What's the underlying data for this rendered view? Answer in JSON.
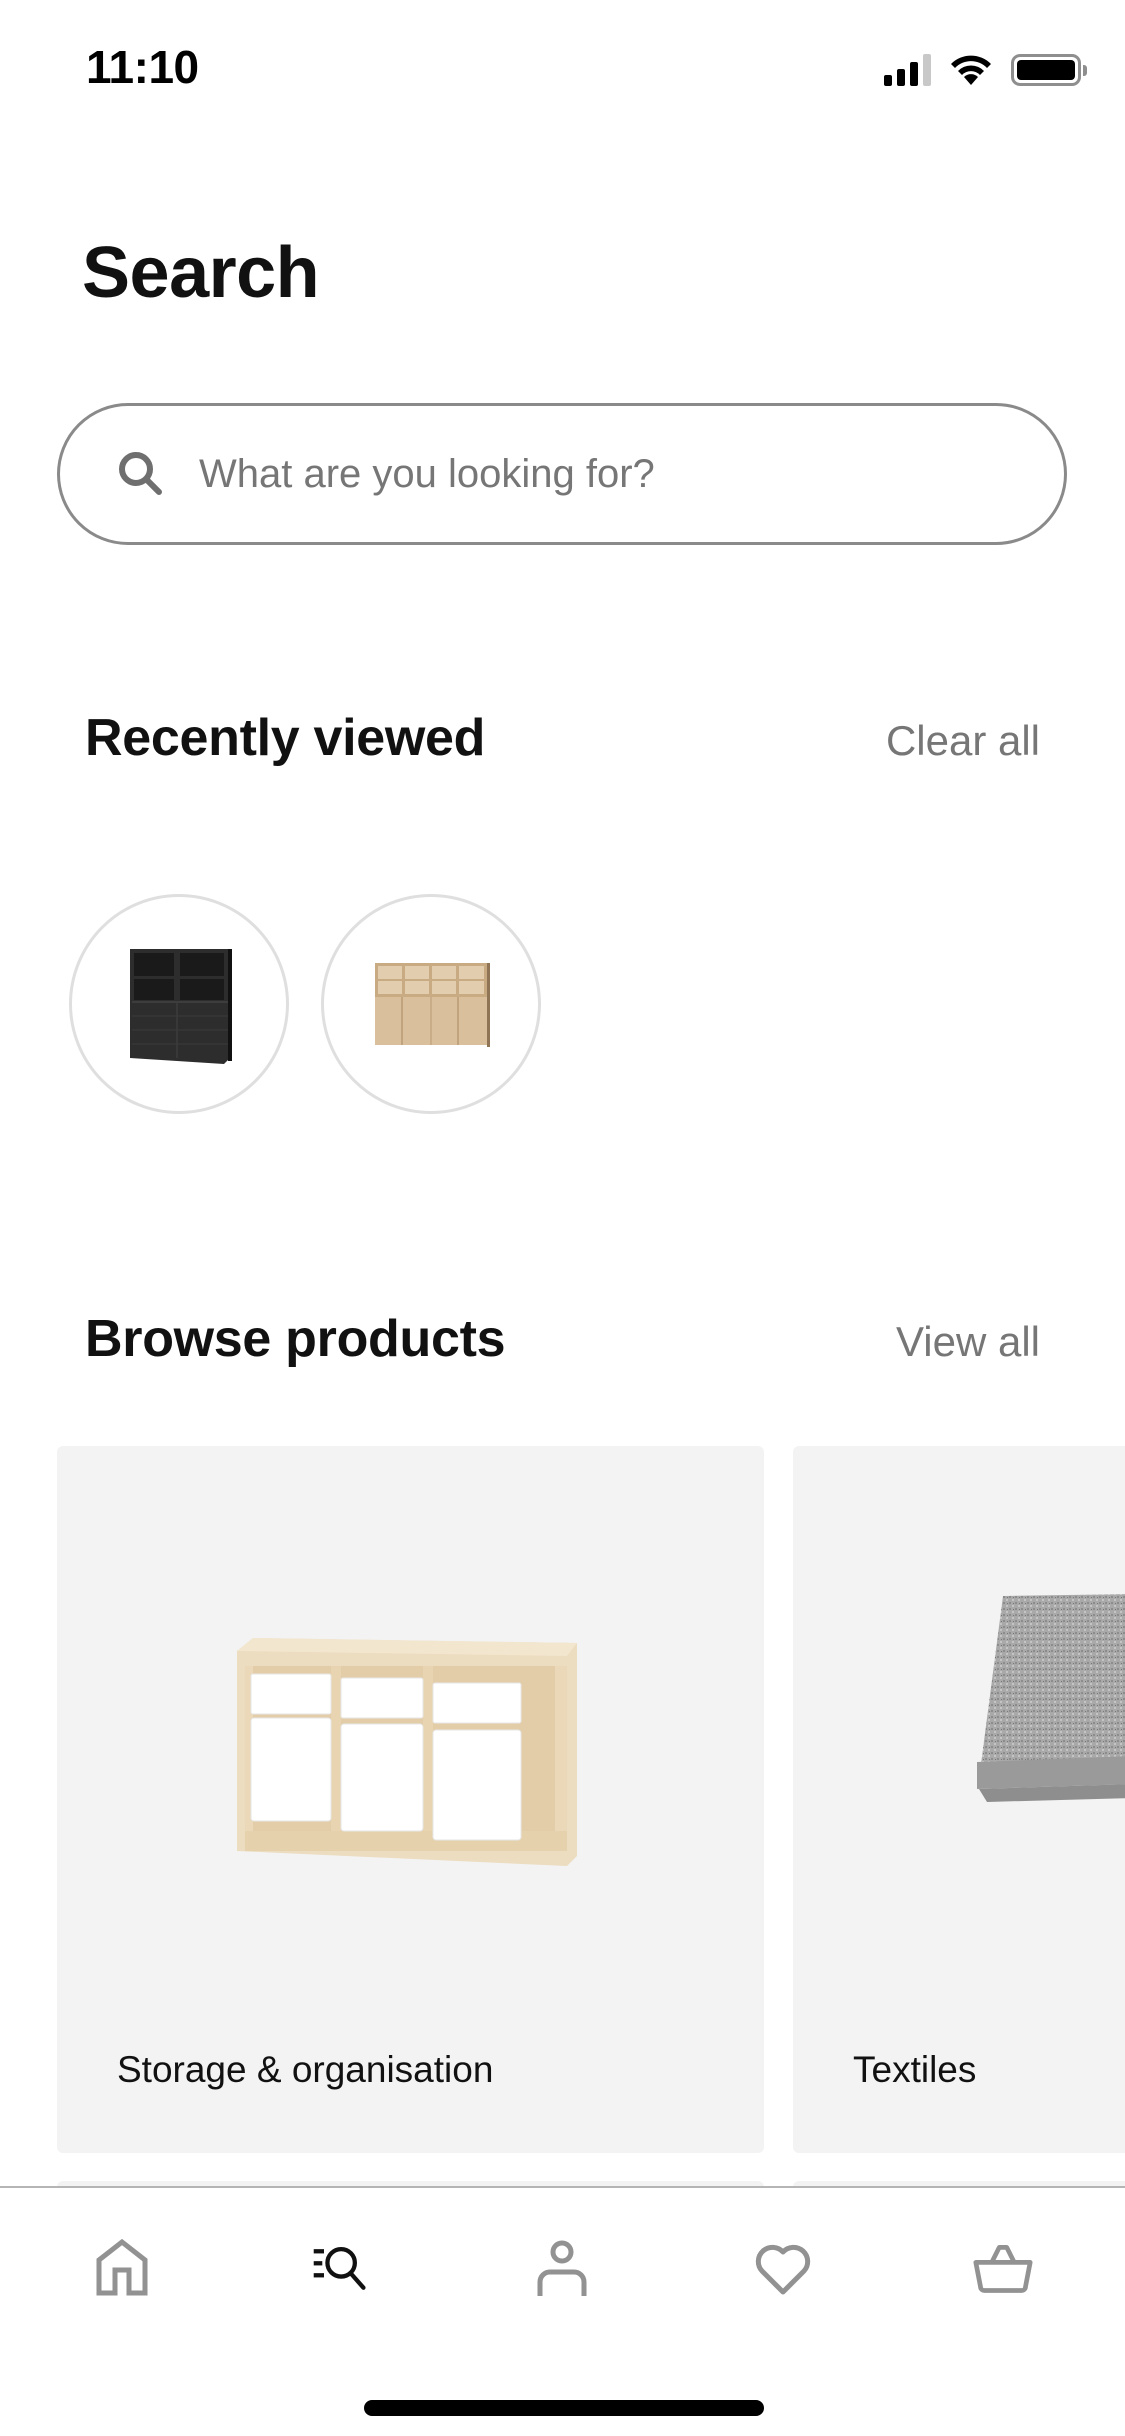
{
  "status_bar": {
    "time": "11:10",
    "signal_bars_active": 3,
    "signal_bars_total": 4,
    "wifi": "wifi-icon",
    "battery_level": 0.95
  },
  "page": {
    "title": "Search"
  },
  "search": {
    "placeholder": "What are you looking for?",
    "value": "",
    "icon": "search-icon"
  },
  "recently_viewed": {
    "title": "Recently viewed",
    "action_label": "Clear all",
    "items": [
      {
        "name": "Black storage combination with open shelves and drawers",
        "color": "#2b2b2b"
      },
      {
        "name": "Light oak storage combination with open shelves and doors",
        "color": "#d9bf9c"
      }
    ]
  },
  "browse_products": {
    "title": "Browse products",
    "action_label": "View all",
    "categories": [
      {
        "label": "Storage & organisation",
        "image": "pine storage frame with white boxes"
      },
      {
        "label": "Textiles",
        "image": "folded grey throw blanket"
      }
    ]
  },
  "bottom_nav": {
    "items": [
      {
        "id": "home",
        "icon": "home-icon",
        "active": false
      },
      {
        "id": "search",
        "icon": "search-list-icon",
        "active": true
      },
      {
        "id": "profile",
        "icon": "person-icon",
        "active": false
      },
      {
        "id": "favourites",
        "icon": "heart-icon",
        "active": false
      },
      {
        "id": "basket",
        "icon": "basket-icon",
        "active": false
      }
    ],
    "active_color": "#111111",
    "inactive_color": "#929292"
  }
}
